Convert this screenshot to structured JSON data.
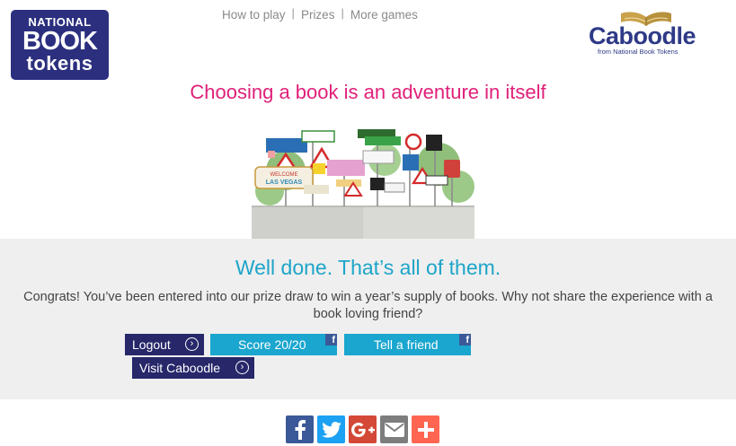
{
  "header": {
    "logo_nbt": {
      "line1": "NATIONAL",
      "line2": "BOOK",
      "line3": "tokens"
    },
    "nav": [
      {
        "label": "How to play"
      },
      {
        "label": "Prizes"
      },
      {
        "label": "More games"
      }
    ],
    "logo_caboodle": {
      "word": "Caboodle",
      "tagline": "from National Book Tokens"
    }
  },
  "headline": "Choosing a book is an adventure in itself",
  "illustration": {
    "sign_text": "WELCOME LAS VEGAS"
  },
  "result": {
    "title": "Well done. That’s all of them.",
    "message": "Congrats! You’ve been entered into our prize draw to win a year’s supply of books. Why not share the experience with a book loving friend?"
  },
  "buttons": {
    "logout": "Logout",
    "score": "Score 20/20",
    "tell_friend": "Tell a friend",
    "visit_caboodle": "Visit Caboodle"
  },
  "share_bar": [
    {
      "icon": "facebook-icon",
      "color": "#3b5998"
    },
    {
      "icon": "twitter-icon",
      "color": "#1da1f2"
    },
    {
      "icon": "google-plus-icon",
      "color": "#d34836"
    },
    {
      "icon": "email-icon",
      "color": "#7d7d7d"
    },
    {
      "icon": "add-more-icon",
      "color": "#ff6550"
    }
  ],
  "colors": {
    "headline": "#e0207a",
    "result_title": "#1ea5c9",
    "dark_button": "#27276a",
    "blue_button": "#1aa6cf",
    "band": "#efefef"
  }
}
